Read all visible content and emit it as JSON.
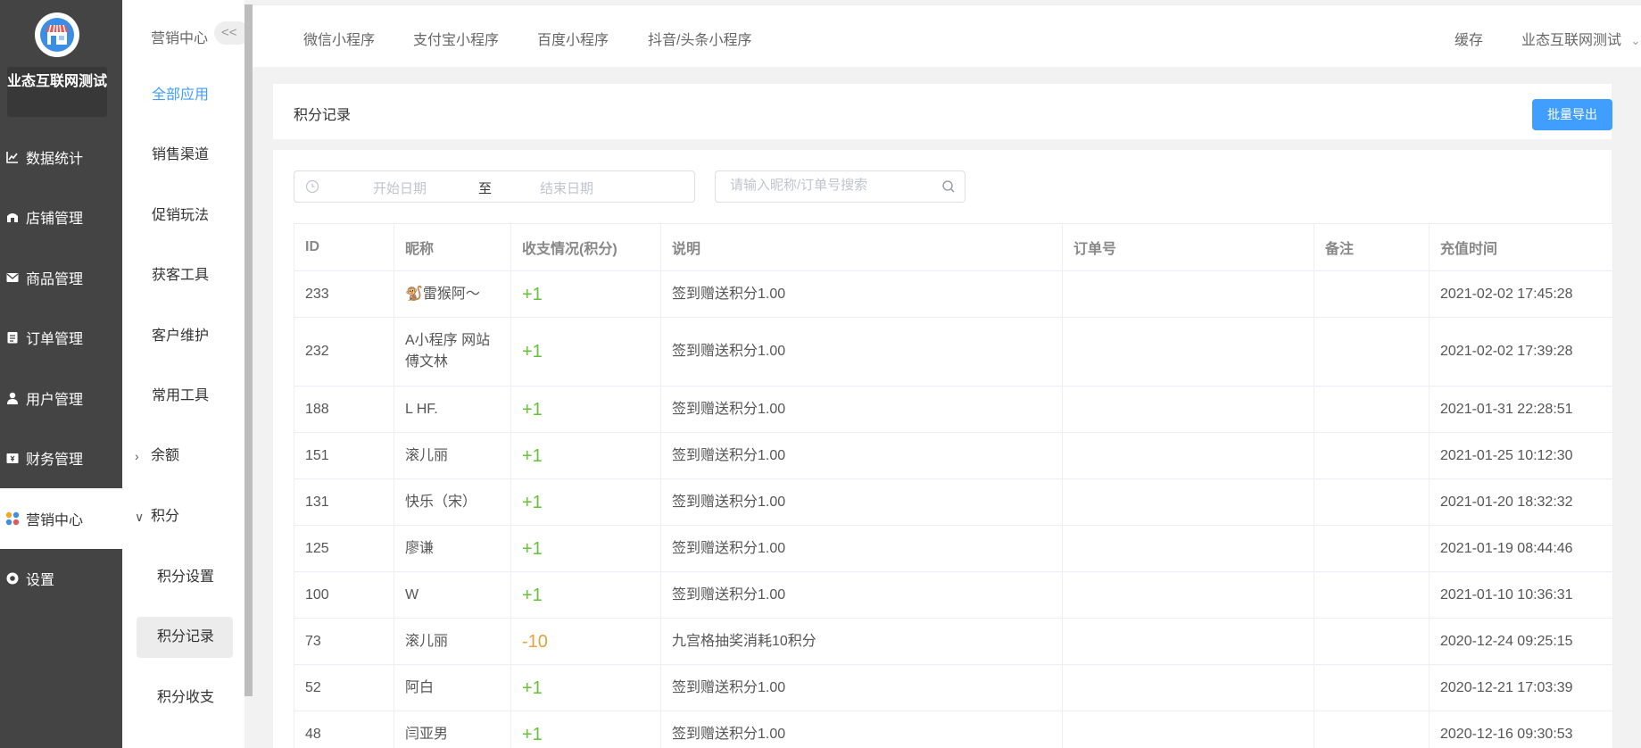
{
  "sidebar": {
    "shop_name": "业态互联网测试",
    "items": [
      {
        "label": "数据统计",
        "icon": "chart-line-icon"
      },
      {
        "label": "店铺管理",
        "icon": "store-icon"
      },
      {
        "label": "商品管理",
        "icon": "mail-icon"
      },
      {
        "label": "订单管理",
        "icon": "clipboard-icon"
      },
      {
        "label": "用户管理",
        "icon": "user-icon"
      },
      {
        "label": "财务管理",
        "icon": "finance-icon"
      },
      {
        "label": "营销中心",
        "icon": "marketing-icon"
      },
      {
        "label": "设置",
        "icon": "settings-icon"
      }
    ],
    "active_index": 6
  },
  "subnav": {
    "title": "营销中心",
    "collapse_label": "<<",
    "items": [
      {
        "label": "全部应用"
      },
      {
        "label": "销售渠道"
      },
      {
        "label": "促销玩法"
      },
      {
        "label": "获客工具"
      },
      {
        "label": "客户维护"
      },
      {
        "label": "常用工具"
      },
      {
        "label": "余额"
      },
      {
        "label": "积分"
      }
    ],
    "children": [
      {
        "label": "积分设置"
      },
      {
        "label": "积分记录"
      },
      {
        "label": "积分收支"
      }
    ]
  },
  "topbar": {
    "tabs": [
      {
        "label": "微信小程序"
      },
      {
        "label": "支付宝小程序"
      },
      {
        "label": "百度小程序"
      },
      {
        "label": "抖音/头条小程序"
      }
    ],
    "cache_label": "缓存",
    "user_label": "业态互联网测试"
  },
  "page": {
    "title": "积分记录",
    "export_label": "批量导出"
  },
  "filters": {
    "start_placeholder": "开始日期",
    "to_label": "至",
    "end_placeholder": "结束日期",
    "search_placeholder": "请输入昵称/订单号搜索"
  },
  "table": {
    "columns": [
      "ID",
      "昵称",
      "收支情况(积分)",
      "说明",
      "订单号",
      "备注",
      "充值时间"
    ],
    "rows": [
      {
        "id": "233",
        "nickname": "🐒雷猴阿～",
        "amount": "+1",
        "desc": "签到赠送积分1.00",
        "order": "",
        "remark": "",
        "time": "2021-02-02 17:45:28"
      },
      {
        "id": "232",
        "nickname": "A小程序 网站 傅文林",
        "amount": "+1",
        "desc": "签到赠送积分1.00",
        "order": "",
        "remark": "",
        "time": "2021-02-02 17:39:28"
      },
      {
        "id": "188",
        "nickname": "L HF.",
        "amount": "+1",
        "desc": "签到赠送积分1.00",
        "order": "",
        "remark": "",
        "time": "2021-01-31 22:28:51"
      },
      {
        "id": "151",
        "nickname": "滚儿丽",
        "amount": "+1",
        "desc": "签到赠送积分1.00",
        "order": "",
        "remark": "",
        "time": "2021-01-25 10:12:30"
      },
      {
        "id": "131",
        "nickname": "快乐（宋）",
        "amount": "+1",
        "desc": "签到赠送积分1.00",
        "order": "",
        "remark": "",
        "time": "2021-01-20 18:32:32"
      },
      {
        "id": "125",
        "nickname": "廖谦",
        "amount": "+1",
        "desc": "签到赠送积分1.00",
        "order": "",
        "remark": "",
        "time": "2021-01-19 08:44:46"
      },
      {
        "id": "100",
        "nickname": "W",
        "amount": "+1",
        "desc": "签到赠送积分1.00",
        "order": "",
        "remark": "",
        "time": "2021-01-10 10:36:31"
      },
      {
        "id": "73",
        "nickname": "滚儿丽",
        "amount": "-10",
        "desc": "九宫格抽奖消耗10积分",
        "order": "",
        "remark": "",
        "time": "2020-12-24 09:25:15"
      },
      {
        "id": "52",
        "nickname": "阿白",
        "amount": "+1",
        "desc": "签到赠送积分1.00",
        "order": "",
        "remark": "",
        "time": "2020-12-21 17:03:39"
      },
      {
        "id": "48",
        "nickname": "闫亚男",
        "amount": "+1",
        "desc": "签到赠送积分1.00",
        "order": "",
        "remark": "",
        "time": "2020-12-16 09:30:53"
      }
    ]
  },
  "colors": {
    "accent": "#409eff",
    "positive": "#67c23a",
    "negative": "#e6a23c",
    "sidebar_bg": "#444444"
  }
}
